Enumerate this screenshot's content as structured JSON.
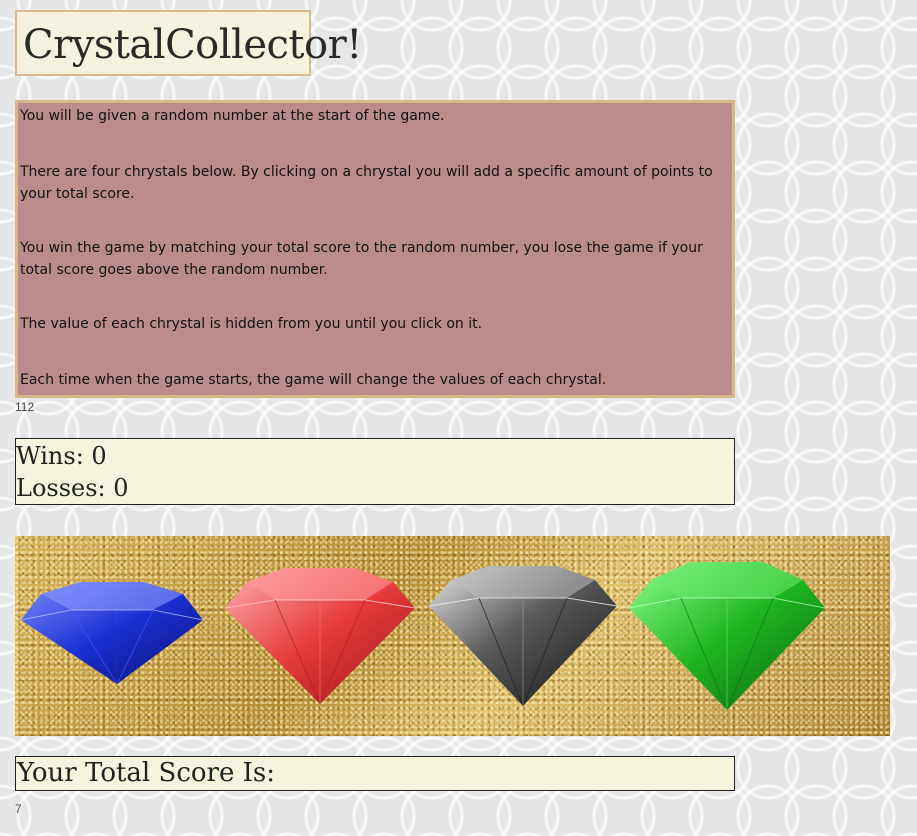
{
  "title": "CrystalCollector!",
  "instructions": [
    "You will be given a random number at the start of the game.",
    "There are four chrystals below. By clicking on a chrystal you will add a specific amount of points to your total score.",
    "You win the game by matching your total score to the random number, you lose the game if your total score goes above the random number.",
    "The value of each chrystal is hidden from you until you click on it.",
    "Each time when the game starts, the game will change the values of each chrystal."
  ],
  "random_number": "112",
  "stats": {
    "wins_label": "Wins: 0",
    "losses_label": "Losses: 0"
  },
  "crystals": [
    {
      "name": "blue-crystal",
      "color": "#1a2fd1"
    },
    {
      "name": "red-crystal",
      "color": "#e53b3b"
    },
    {
      "name": "black-crystal",
      "color": "#3a3a3a"
    },
    {
      "name": "green-crystal",
      "color": "#1fb51f"
    }
  ],
  "score": {
    "label": "Your Total Score Is:",
    "value": "7"
  },
  "colors": {
    "instructions_bg": "#bc8c8c",
    "box_border": "#d9b98a",
    "panel_gold": "#c9a24a",
    "box_bg": "#f5f5df"
  }
}
